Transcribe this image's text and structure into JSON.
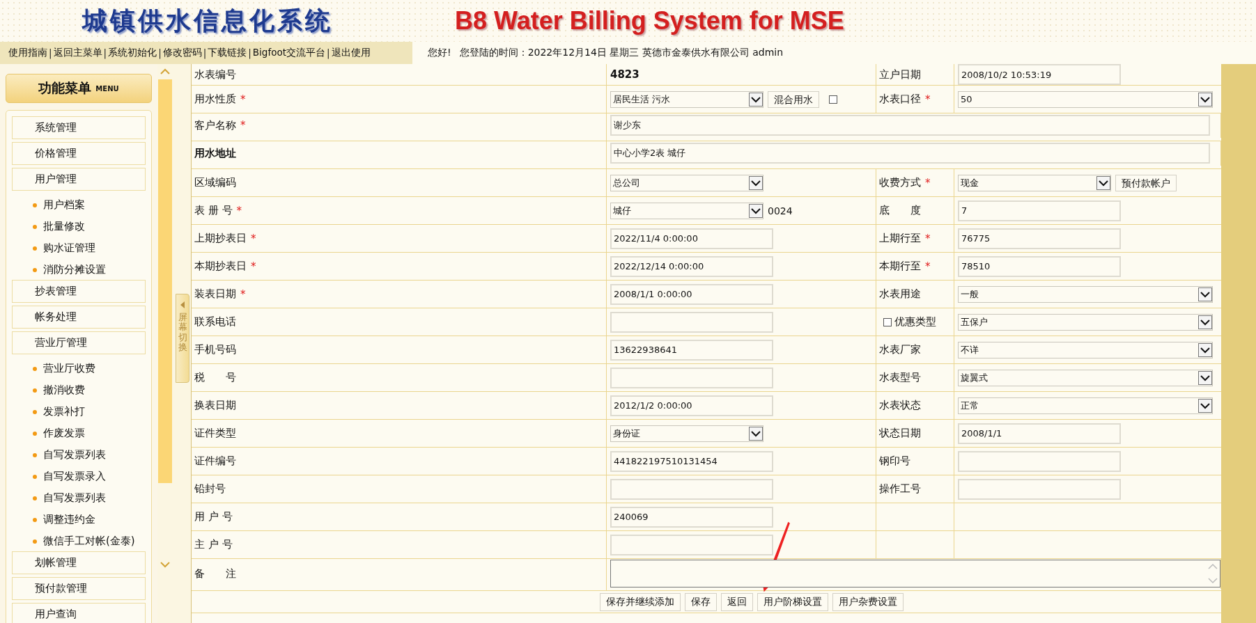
{
  "header": {
    "title_cn": "城镇供水信息化系统",
    "title_en": "B8 Water Billing System for MSE"
  },
  "nav": {
    "links": [
      "使用指南",
      "返回主菜单",
      "系统初始化",
      "修改密码",
      "下载链接",
      "Bigfoot交流平台",
      "退出使用"
    ],
    "separator": "|",
    "greeting": "您好!",
    "login_info": "您登陆的时间：2022年12月14日 星期三 英德市金泰供水有限公司 admin"
  },
  "sidebar": {
    "title": "功能菜单",
    "title_en": "MENU",
    "items": [
      {
        "label": "系统管理"
      },
      {
        "label": "价格管理"
      },
      {
        "label": "用户管理",
        "children": [
          {
            "label": "用户档案"
          },
          {
            "label": "批量修改"
          },
          {
            "label": "购水证管理"
          },
          {
            "label": "消防分摊设置"
          }
        ]
      },
      {
        "label": "抄表管理"
      },
      {
        "label": "帐务处理"
      },
      {
        "label": "营业厅管理",
        "children": [
          {
            "label": "营业厅收费"
          },
          {
            "label": "撤消收费"
          },
          {
            "label": "发票补打"
          },
          {
            "label": "作废发票"
          },
          {
            "label": "自写发票列表"
          },
          {
            "label": "自写发票录入"
          },
          {
            "label": "自写发票列表"
          },
          {
            "label": "调整违约金"
          },
          {
            "label": "微信手工对帐(金泰)"
          }
        ]
      },
      {
        "label": "划帐管理"
      },
      {
        "label": "预付款管理"
      },
      {
        "label": "用户查询"
      }
    ]
  },
  "toggle_tab": {
    "label": "屏幕切换"
  },
  "form": {
    "rows": [
      {
        "kind": "pair",
        "left": {
          "label": "水表编号",
          "bold": false,
          "field": {
            "kind": "static",
            "value": "4823"
          }
        },
        "right": {
          "label": "立户日期",
          "bold": false,
          "field": {
            "kind": "text",
            "value": "2008/10/2 10:53:19"
          }
        }
      },
      {
        "kind": "pair",
        "left": {
          "label": "用水性质",
          "mark": "*",
          "bold": false,
          "field": {
            "kind": "select",
            "value": "居民生活 污水"
          },
          "extras": [
            {
              "kind": "button",
              "label": "混合用水"
            },
            {
              "kind": "checkbox",
              "checked": false
            }
          ]
        },
        "right": {
          "label": "水表口径",
          "mark": "*",
          "bold": false,
          "field": {
            "kind": "select",
            "value": "50"
          }
        }
      },
      {
        "kind": "wide",
        "left": {
          "label": "客户名称",
          "mark": "*",
          "bold": false,
          "field": {
            "kind": "text",
            "value": "谢少东"
          }
        }
      },
      {
        "kind": "wide",
        "left": {
          "label": "用水地址",
          "bold": true,
          "field": {
            "kind": "text",
            "value": "中心小学2表 城仔"
          }
        }
      },
      {
        "kind": "pair",
        "left": {
          "label": "区域编码",
          "bold": false,
          "field": {
            "kind": "select",
            "value": "总公司"
          }
        },
        "right": {
          "label": "收费方式",
          "mark": "*",
          "bold": false,
          "field": {
            "kind": "select",
            "value": "现金"
          },
          "extras": [
            {
              "kind": "button",
              "label": "预付款帐户"
            }
          ]
        }
      },
      {
        "kind": "pair",
        "left": {
          "label": "表 册 号",
          "mark": "*",
          "bold": false,
          "field": {
            "kind": "select",
            "value": "城仔"
          },
          "extras": [
            {
              "kind": "note",
              "label": "0024"
            }
          ]
        },
        "right": {
          "label": "底　　度",
          "bold": false,
          "field": {
            "kind": "text",
            "value": "7"
          }
        }
      },
      {
        "kind": "pair",
        "left": {
          "label": "上期抄表日",
          "mark": "*",
          "bold": false,
          "field": {
            "kind": "text",
            "value": "2022/11/4 0:00:00"
          }
        },
        "right": {
          "label": "上期行至",
          "mark": "*",
          "bold": false,
          "field": {
            "kind": "text",
            "value": "76775"
          }
        }
      },
      {
        "kind": "pair",
        "left": {
          "label": "本期抄表日",
          "mark": "*",
          "bold": false,
          "field": {
            "kind": "text",
            "value": "2022/12/14 0:00:00"
          }
        },
        "right": {
          "label": "本期行至",
          "mark": "*",
          "bold": false,
          "field": {
            "kind": "text",
            "value": "78510"
          }
        }
      },
      {
        "kind": "pair",
        "left": {
          "label": "装表日期",
          "mark": "*",
          "bold": false,
          "field": {
            "kind": "text",
            "value": "2008/1/1 0:00:00"
          }
        },
        "right": {
          "label": "水表用途",
          "bold": false,
          "field": {
            "kind": "select",
            "value": "一般"
          }
        }
      },
      {
        "kind": "pair",
        "left": {
          "label": "联系电话",
          "bold": false,
          "field": {
            "kind": "text"
          }
        },
        "right": {
          "label": "优惠类型",
          "bold": false,
          "checkbox": {
            "checked": false
          },
          "field": {
            "kind": "select",
            "value": "五保户"
          }
        }
      },
      {
        "kind": "pair",
        "left": {
          "label": "手机号码",
          "bold": false,
          "field": {
            "kind": "text",
            "value": "13622938641"
          }
        },
        "right": {
          "label": "水表厂家",
          "bold": false,
          "field": {
            "kind": "select",
            "value": "不详"
          }
        }
      },
      {
        "kind": "pair",
        "left": {
          "label": "税　　号",
          "bold": false,
          "field": {
            "kind": "text"
          }
        },
        "right": {
          "label": "水表型号",
          "bold": false,
          "field": {
            "kind": "select",
            "value": "旋翼式"
          }
        }
      },
      {
        "kind": "pair",
        "left": {
          "label": "换表日期",
          "bold": false,
          "field": {
            "kind": "text",
            "value": "2012/1/2 0:00:00"
          }
        },
        "right": {
          "label": "水表状态",
          "bold": false,
          "field": {
            "kind": "select",
            "value": "正常"
          }
        }
      },
      {
        "kind": "pair",
        "left": {
          "label": "证件类型",
          "bold": false,
          "field": {
            "kind": "select",
            "value": "身份证"
          }
        },
        "right": {
          "label": "状态日期",
          "bold": false,
          "field": {
            "kind": "text",
            "value": "2008/1/1"
          }
        }
      },
      {
        "kind": "pair",
        "left": {
          "label": "证件编号",
          "bold": false,
          "field": {
            "kind": "text",
            "value": "441822197510131454"
          }
        },
        "right": {
          "label": "钢印号",
          "bold": false,
          "field": {
            "kind": "text"
          }
        }
      },
      {
        "kind": "pair",
        "left": {
          "label": "铅封号",
          "bold": false,
          "field": {
            "kind": "text"
          }
        },
        "right": {
          "label": "操作工号",
          "bold": false,
          "field": {
            "kind": "text"
          }
        }
      },
      {
        "kind": "pair",
        "left": {
          "label": "用 户 号",
          "bold": false,
          "field": {
            "kind": "text",
            "value": "240069"
          }
        }
      },
      {
        "kind": "pair",
        "left": {
          "label": "主 户 号",
          "bold": false,
          "field": {
            "kind": "text"
          }
        }
      },
      {
        "kind": "remark",
        "left": {
          "label": "备　　注",
          "bold": false,
          "field": {
            "kind": "textarea"
          }
        }
      }
    ],
    "buttons": [
      "保存并继续添加",
      "保存",
      "返回",
      "用户阶梯设置",
      "用户杂费设置"
    ]
  }
}
